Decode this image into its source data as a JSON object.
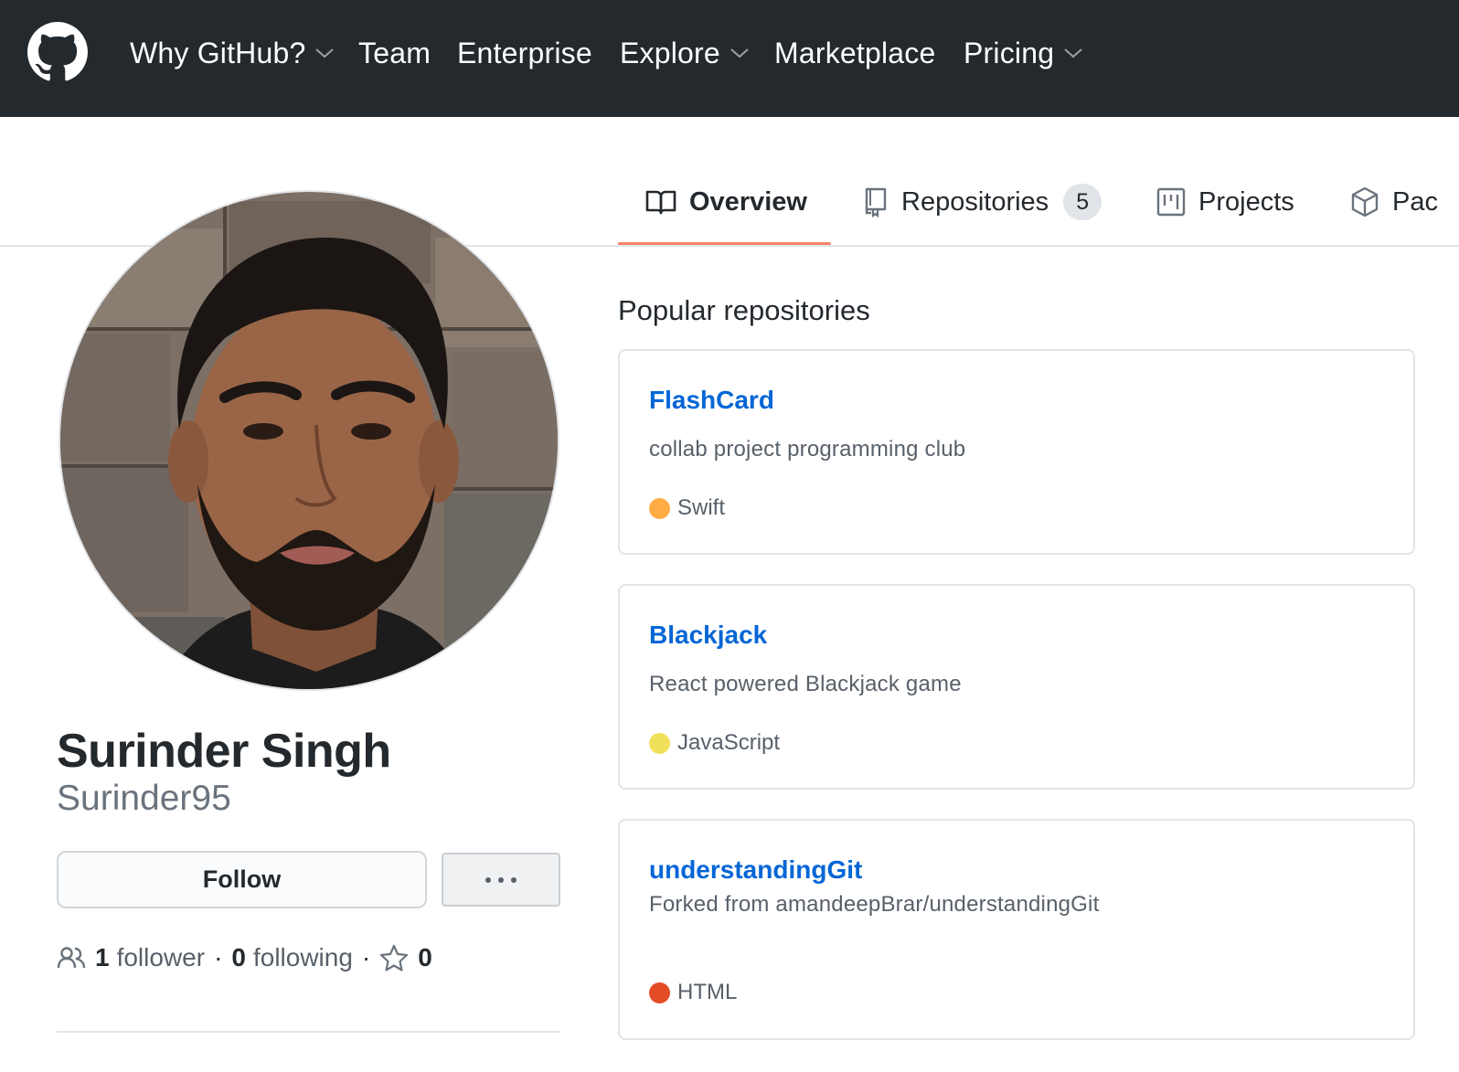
{
  "header": {
    "nav": [
      {
        "label": "Why GitHub?",
        "has_dropdown": true
      },
      {
        "label": "Team",
        "has_dropdown": false
      },
      {
        "label": "Enterprise",
        "has_dropdown": false
      },
      {
        "label": "Explore",
        "has_dropdown": true
      },
      {
        "label": "Marketplace",
        "has_dropdown": false
      },
      {
        "label": "Pricing",
        "has_dropdown": true
      }
    ]
  },
  "tabs": [
    {
      "label": "Overview",
      "icon": "book-icon",
      "active": true
    },
    {
      "label": "Repositories",
      "icon": "repo-icon",
      "count": "5"
    },
    {
      "label": "Projects",
      "icon": "project-icon"
    },
    {
      "label": "Pac",
      "icon": "package-icon"
    }
  ],
  "profile": {
    "full_name": "Surinder Singh",
    "username": "Surinder95",
    "follow_label": "Follow",
    "more_label": "···",
    "followers_count": "1",
    "followers_label": "follower",
    "following_count": "0",
    "following_label": "following",
    "stars_count": "0",
    "separator": "·"
  },
  "popular": {
    "title": "Popular repositories",
    "repos": [
      {
        "name": "FlashCard",
        "description": "collab project programming club",
        "language": "Swift",
        "language_color": "#ffac45"
      },
      {
        "name": "Blackjack",
        "description": "React powered Blackjack game",
        "language": "JavaScript",
        "language_color": "#f1e05a"
      },
      {
        "name": "understandingGit",
        "description": "Forked from amandeepBrar/understandingGit",
        "language": "HTML",
        "language_color": "#e34c26"
      }
    ]
  },
  "colors": {
    "header_bg": "#24292e",
    "link": "#0366d6",
    "active_tab_underline": "#f9826c"
  }
}
